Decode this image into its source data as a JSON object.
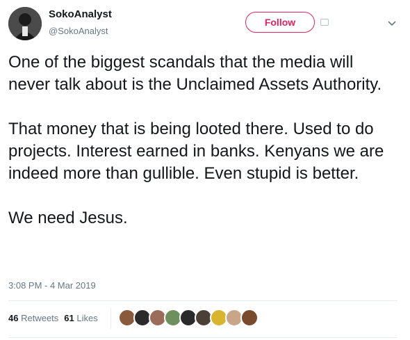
{
  "author": {
    "name": "SokoAnalyst",
    "handle": "@SokoAnalyst"
  },
  "follow_button": {
    "label": "Follow",
    "color": "#e0245e"
  },
  "tweet": {
    "text": "One of the biggest scandals that the media will never talk about is the Unclaimed Assets Authority.\n\nThat money that is being looted there. Used to do projects. Interest earned in banks. Kenyans we are indeed more than gullible. Even stupid is better.\n\nWe need Jesus."
  },
  "timestamp": "3:08 PM - 4 Mar 2019",
  "stats": {
    "retweets_count": "46",
    "retweets_label": "Retweets",
    "likes_count": "61",
    "likes_label": "Likes"
  },
  "likers": [
    {
      "color": "#8a5a3c"
    },
    {
      "color": "#2b2b2b"
    },
    {
      "color": "#9c6b5a"
    },
    {
      "color": "#6f8f5e"
    },
    {
      "color": "#2a2a2a"
    },
    {
      "color": "#4a4036"
    },
    {
      "color": "#d9b430"
    },
    {
      "color": "#c9a58a"
    },
    {
      "color": "#7a4a2e"
    }
  ],
  "colors": {
    "text": "#14171a",
    "secondary": "#657786",
    "border": "#e6ecf0"
  }
}
